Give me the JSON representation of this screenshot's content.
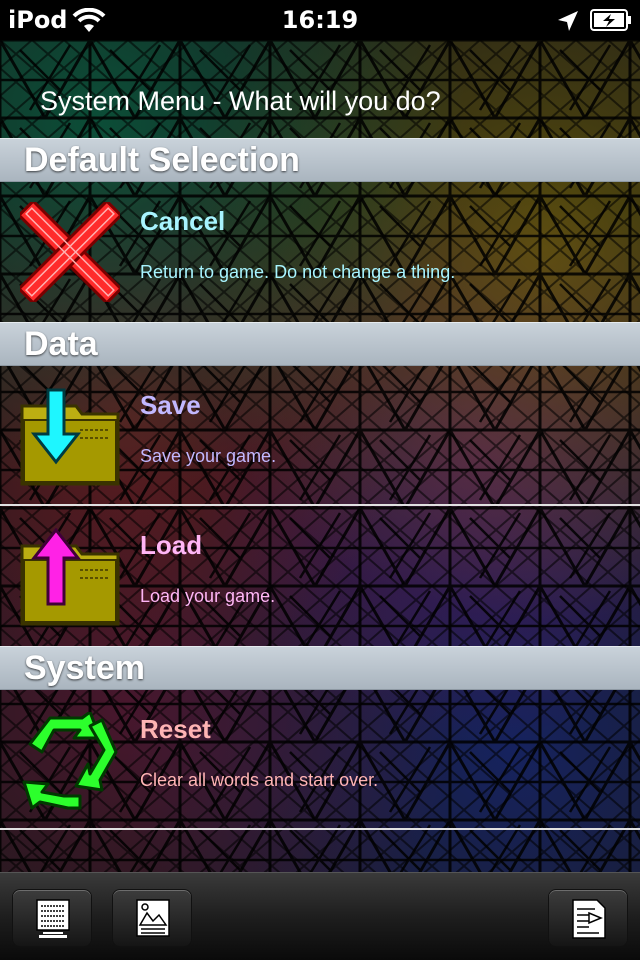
{
  "status_bar": {
    "carrier": "iPod",
    "time": "16:19",
    "icons": [
      "wifi-icon",
      "location-arrow-icon",
      "battery-charging-icon"
    ]
  },
  "menu": {
    "title": "System Menu - What will you do?"
  },
  "sections": [
    {
      "header": "Default Selection",
      "items": [
        {
          "icon": "red-x-cancel-icon",
          "title": "Cancel",
          "description": "Return to game.  Do not change a thing.",
          "title_color": "#a8f4ff",
          "desc_color": "#a8f4ff"
        }
      ]
    },
    {
      "header": "Data",
      "items": [
        {
          "icon": "folder-save-arrow-icon",
          "title": "Save",
          "description": "Save your game.",
          "title_color": "#c2b8ff",
          "desc_color": "#c2b8ff"
        },
        {
          "icon": "folder-load-arrow-icon",
          "title": "Load",
          "description": "Load your game.",
          "title_color": "#ffb6f6",
          "desc_color": "#ffb6f6"
        }
      ]
    },
    {
      "header": "System",
      "items": [
        {
          "icon": "green-recycle-reset-icon",
          "title": "Reset",
          "description": "Clear all words and start over.",
          "title_color": "#ffb4b4",
          "desc_color": "#ffb4b4"
        }
      ]
    }
  ],
  "toolbar": {
    "buttons": [
      "document-list-icon",
      "picture-document-icon",
      "document-export-icon"
    ]
  }
}
